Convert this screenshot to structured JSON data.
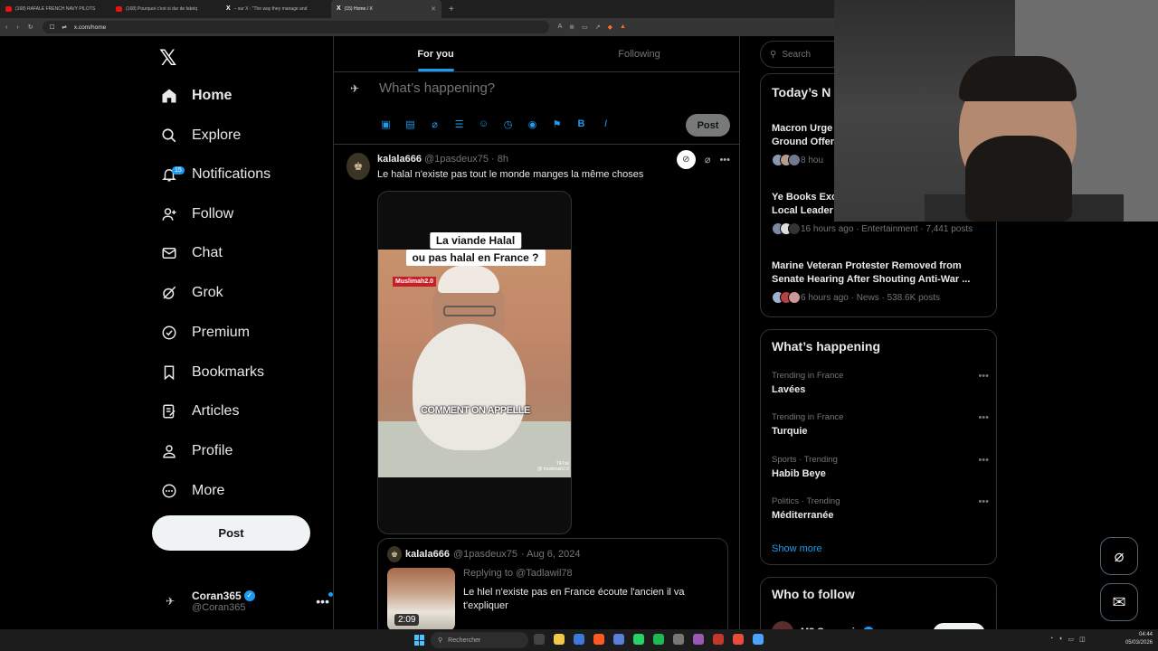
{
  "browser": {
    "tabs": [
      {
        "label": "(168) RAFALE FRENCH NAVY PILOTS",
        "active": false
      },
      {
        "label": "(168) Pourquoi c'est si dur de fabriq",
        "active": false
      },
      {
        "label": "– sur X : \"The way they manage and",
        "active": false
      },
      {
        "label": "(15) Home / X",
        "active": true
      }
    ],
    "new_tab": "+",
    "url": "x.com/home"
  },
  "nav": {
    "logo": "𝕏",
    "items": [
      {
        "label": "Home",
        "icon": "home-icon"
      },
      {
        "label": "Explore",
        "icon": "search-icon"
      },
      {
        "label": "Notifications",
        "icon": "bell-icon",
        "badge": "15"
      },
      {
        "label": "Follow",
        "icon": "follow-icon"
      },
      {
        "label": "Chat",
        "icon": "mail-icon"
      },
      {
        "label": "Grok",
        "icon": "grok-icon"
      },
      {
        "label": "Premium",
        "icon": "premium-icon"
      },
      {
        "label": "Bookmarks",
        "icon": "bookmark-icon"
      },
      {
        "label": "Articles",
        "icon": "articles-icon"
      },
      {
        "label": "Profile",
        "icon": "profile-icon"
      },
      {
        "label": "More",
        "icon": "more-icon"
      }
    ],
    "post_label": "Post",
    "account": {
      "name": "Coran365",
      "handle": "@Coran365"
    }
  },
  "feed": {
    "tabs": [
      "For you",
      "Following"
    ],
    "compose_placeholder": "What’s happening?",
    "compose_post": "Post",
    "tweet": {
      "name": "kalala666",
      "handle": "@1pasdeux75",
      "time": "· 8h",
      "text": "Le halal n'existe pas tout le monde manges la même choses",
      "video_caption_1": "La viande Halal",
      "video_caption_2": "ou pas halal en France ?",
      "video_watermark": "Muslimah2.0",
      "video_subtitle": "COMMENT ON APPELLE",
      "video_tiktok": "TikTok",
      "video_tiktok_handle": "@ muslimah2.0",
      "quote": {
        "name": "kalala666",
        "handle": "@1pasdeux75",
        "date": "· Aug 6, 2024",
        "replying_label": "Replying to",
        "replying_to": "@Tadlawil78",
        "text": "Le hlel n'existe pas en France écoute l'ancien il va t'expliquer",
        "duration": "2:09"
      }
    }
  },
  "right": {
    "search_placeholder": "Search",
    "news": {
      "title": "Today’s N",
      "items": [
        {
          "title": "Macron Urge\nGround Offer",
          "meta": "8 hou"
        },
        {
          "title": "Ye Books Exc\nLocal Leader",
          "meta": "16 hours ago · Entertainment · 7,441 posts"
        },
        {
          "title": "Marine Veteran Protester Removed from Senate Hearing After Shouting Anti-War ...",
          "meta": "6 hours ago · News · 538.6K posts"
        }
      ]
    },
    "happening": {
      "title": "What’s happening",
      "trends": [
        {
          "context": "Trending in France",
          "name": "Lavées"
        },
        {
          "context": "Trending in France",
          "name": "Turquie"
        },
        {
          "context": "Sports · Trending",
          "name": "Habib Beye"
        },
        {
          "context": "Politics · Trending",
          "name": "Méditerranée"
        }
      ],
      "show_more": "Show more"
    },
    "who_to_follow": {
      "title": "Who to follow",
      "name": "M8 Squeezie",
      "follow": "Follow"
    }
  },
  "taskbar": {
    "search_placeholder": "Rechercher",
    "time": "04:44",
    "date": "05/03/2026"
  },
  "colors": {
    "accent": "#1d9bf0",
    "background": "#000000",
    "border": "#2f3336",
    "muted": "#71767b"
  }
}
